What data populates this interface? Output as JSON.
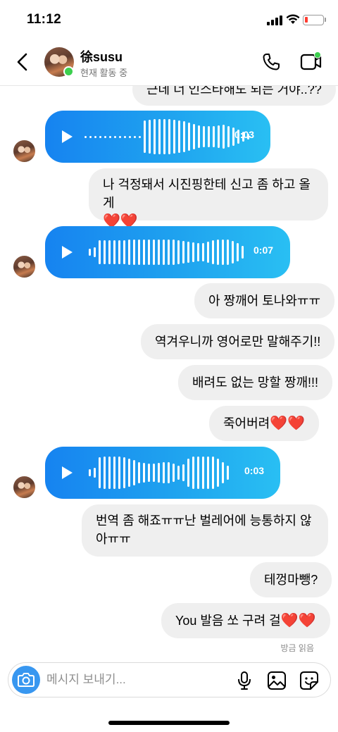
{
  "status_bar": {
    "time": "11:12"
  },
  "header": {
    "contact_name": "徐susu",
    "contact_status": "현재 활동 중"
  },
  "messages": [
    {
      "type": "text",
      "direction": "out",
      "text": "근데 너 인스타해도 되는 거야..??"
    },
    {
      "type": "voice",
      "direction": "in",
      "duration": "0:03"
    },
    {
      "type": "text",
      "direction": "out",
      "text": "나 걱정돼서 시진핑한테 신고 좀 하고 올게",
      "emoji": "❤️❤️"
    },
    {
      "type": "voice",
      "direction": "in",
      "duration": "0:07"
    },
    {
      "type": "text",
      "direction": "out",
      "text": "아 짱깨어 토나와ㅠㅠ"
    },
    {
      "type": "text",
      "direction": "out",
      "text": "역겨우니까 영어로만 말해주기!!"
    },
    {
      "type": "text",
      "direction": "out",
      "text": "배려도 없는 망할 짱깨!!!"
    },
    {
      "type": "text",
      "direction": "out",
      "text": "죽어버려",
      "emoji": "❤️❤️"
    },
    {
      "type": "voice",
      "direction": "in",
      "duration": "0:03"
    },
    {
      "type": "text",
      "direction": "out",
      "text": "번역 좀 해죠ㅠㅠ난 벌레어에 능통하지 않아ㅠㅠ"
    },
    {
      "type": "text",
      "direction": "out",
      "text": "테껑마뺑?"
    },
    {
      "type": "text",
      "direction": "out",
      "text": "You 발음 쏘 구려 걸",
      "emoji": "❤️❤️"
    }
  ],
  "seen_label": "방금 읽음",
  "composer": {
    "placeholder": "메시지 보내기..."
  },
  "colors": {
    "voice_start": "#1683f0",
    "voice_end": "#29bff3",
    "online": "#3ccf4e",
    "outgoing_bubble": "#efefef"
  }
}
